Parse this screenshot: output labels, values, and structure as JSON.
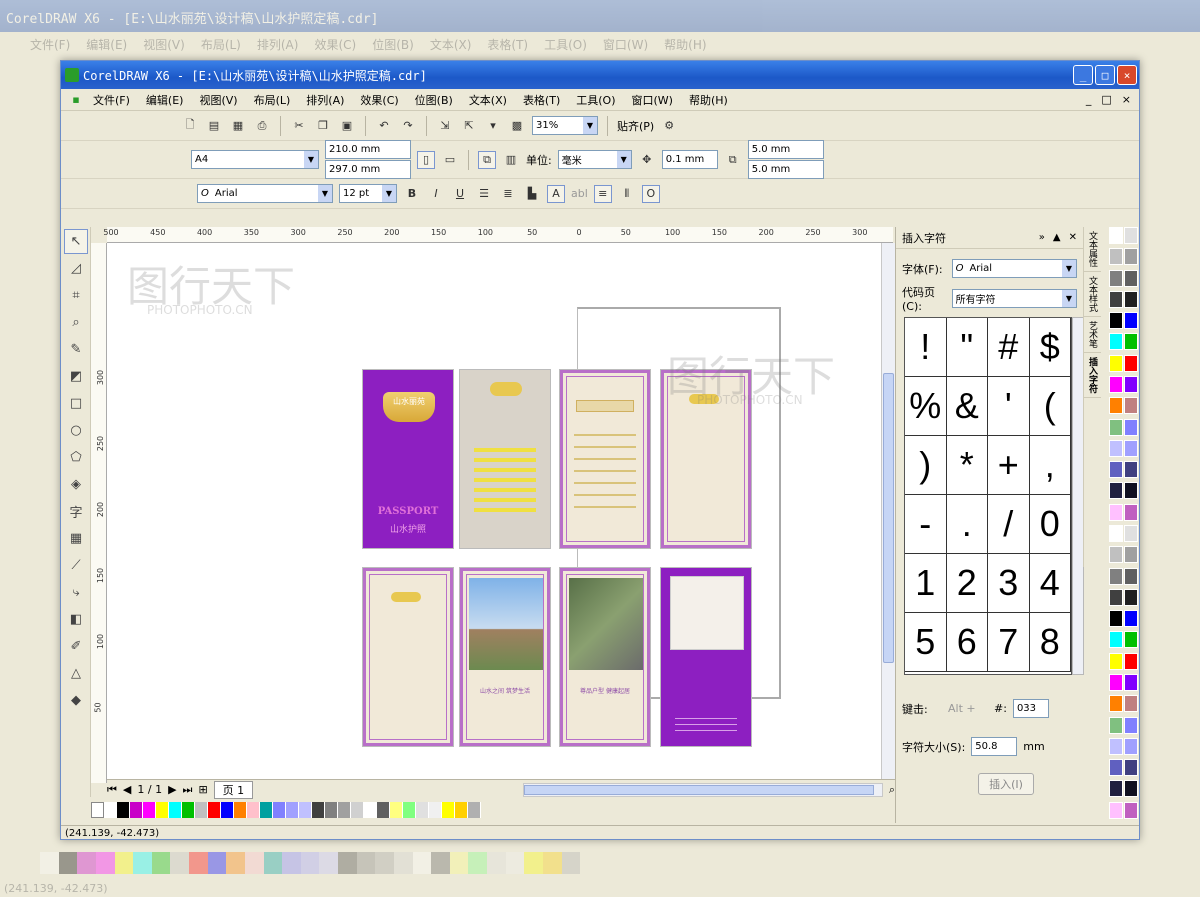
{
  "background_app": {
    "title": "CorelDRAW X6 - [E:\\山水丽苑\\设计稿\\山水护照定稿.cdr]",
    "menu": [
      "文件(F)",
      "编辑(E)",
      "视图(V)",
      "布局(L)",
      "排列(A)",
      "效果(C)",
      "位图(B)",
      "文本(X)",
      "表格(T)",
      "工具(O)",
      "窗口(W)",
      "帮助(H)"
    ],
    "coords": "(241.139, -42.473)"
  },
  "window": {
    "title": "CorelDRAW X6 - [E:\\山水丽苑\\设计稿\\山水护照定稿.cdr]",
    "controls": [
      "_",
      "□",
      "×"
    ]
  },
  "menu": {
    "items": [
      "文件(F)",
      "编辑(E)",
      "视图(V)",
      "布局(L)",
      "排列(A)",
      "效果(C)",
      "位图(B)",
      "文本(X)",
      "表格(T)",
      "工具(O)",
      "窗口(W)",
      "帮助(H)"
    ],
    "doc_controls": [
      "_",
      "□",
      "×"
    ]
  },
  "toolbar": {
    "zoom": "31%",
    "snap": "贴齐(P)"
  },
  "property_bar": {
    "page_size": "A4",
    "width": "210.0 mm",
    "height": "297.0 mm",
    "unit_label": "单位:",
    "unit": "毫米",
    "nudge": "0.1 mm",
    "dup_x": "5.0 mm",
    "dup_y": "5.0 mm"
  },
  "text_bar": {
    "font": "Arial",
    "size": "12 pt",
    "sample": "abl"
  },
  "ruler": {
    "h_ticks": [
      "500",
      "450",
      "400",
      "350",
      "300",
      "250",
      "200",
      "150",
      "100",
      "50",
      "0",
      "50",
      "100",
      "150",
      "200",
      "250",
      "300",
      "350"
    ],
    "v_ticks": [
      "300",
      "250",
      "200",
      "150",
      "100",
      "50"
    ]
  },
  "pages": {
    "passport_title": "PASSPORT",
    "passport_sub": "山水护照",
    "brand": "山水丽苑",
    "slogan1": "山水之间 筑梦生活",
    "slogan2": "尊品户型 健康起居"
  },
  "navigator": {
    "page_count": "1 / 1",
    "page_tab": "页 1"
  },
  "docker": {
    "title": "插入字符",
    "font_label": "字体(F):",
    "font": "Arial",
    "code_page_label": "代码页(C):",
    "code_page": "所有字符",
    "chars": [
      "!",
      "\"",
      "#",
      "$",
      "%",
      "&",
      "'",
      "(",
      ")",
      "*",
      "+",
      ",",
      "-",
      ".",
      "/",
      "0",
      "1",
      "2",
      "3",
      "4",
      "5",
      "6",
      "7",
      "8"
    ],
    "shortcut_label": "键击:",
    "shortcut_value": "Alt +",
    "code_prefix": "#:",
    "code_value": "033",
    "char_size_label": "字符大小(S):",
    "char_size": "50.8",
    "char_size_unit": "mm",
    "insert_button": "插入(I)",
    "tabs": [
      "文本属性",
      "文本样式",
      "艺术笔",
      "插入字符"
    ]
  },
  "status": {
    "coords": "(241.139, -42.473)"
  },
  "watermark": {
    "brand": "图行天下",
    "url": "PHOTOPHOTO.CN"
  },
  "colors": {
    "title_bar": "#1c58c8",
    "page_purple": "#8d1fc1",
    "frame_border": "#b86fc8"
  },
  "palette": [
    "#ffffff",
    "#000000",
    "#c800c8",
    "#ff00ff",
    "#ffff00",
    "#00ffff",
    "#00c000",
    "#c0c0c0",
    "#ff0000",
    "#0000ff",
    "#ff8000",
    "#ffc0cb",
    "#00a0a0",
    "#8080ff",
    "#a0a0ff",
    "#c0c0ff",
    "#404040",
    "#808080",
    "#a0a0a0",
    "#d0d0d0",
    "#ffffff",
    "#606060",
    "#ffff80",
    "#80ff80",
    "#e0e0e0",
    "#f0f0f0",
    "#ffff00",
    "#ffd000",
    "#b0b0b0"
  ]
}
